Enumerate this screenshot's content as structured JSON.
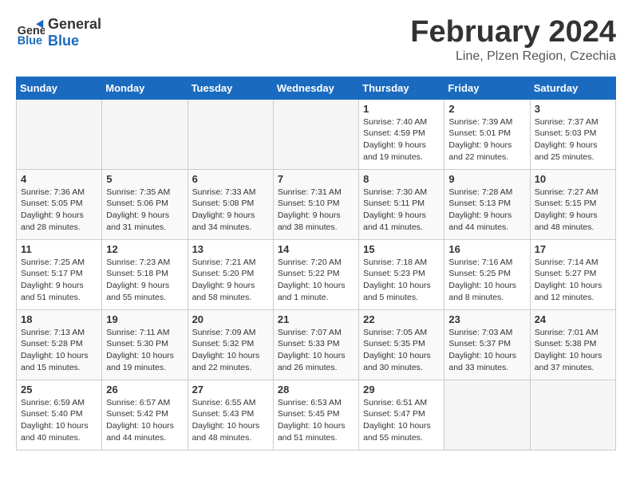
{
  "header": {
    "logo_line1": "General",
    "logo_line2": "Blue",
    "title": "February 2024",
    "subtitle": "Line, Plzen Region, Czechia"
  },
  "weekdays": [
    "Sunday",
    "Monday",
    "Tuesday",
    "Wednesday",
    "Thursday",
    "Friday",
    "Saturday"
  ],
  "weeks": [
    [
      {
        "day": "",
        "info": ""
      },
      {
        "day": "",
        "info": ""
      },
      {
        "day": "",
        "info": ""
      },
      {
        "day": "",
        "info": ""
      },
      {
        "day": "1",
        "info": "Sunrise: 7:40 AM\nSunset: 4:59 PM\nDaylight: 9 hours\nand 19 minutes."
      },
      {
        "day": "2",
        "info": "Sunrise: 7:39 AM\nSunset: 5:01 PM\nDaylight: 9 hours\nand 22 minutes."
      },
      {
        "day": "3",
        "info": "Sunrise: 7:37 AM\nSunset: 5:03 PM\nDaylight: 9 hours\nand 25 minutes."
      }
    ],
    [
      {
        "day": "4",
        "info": "Sunrise: 7:36 AM\nSunset: 5:05 PM\nDaylight: 9 hours\nand 28 minutes."
      },
      {
        "day": "5",
        "info": "Sunrise: 7:35 AM\nSunset: 5:06 PM\nDaylight: 9 hours\nand 31 minutes."
      },
      {
        "day": "6",
        "info": "Sunrise: 7:33 AM\nSunset: 5:08 PM\nDaylight: 9 hours\nand 34 minutes."
      },
      {
        "day": "7",
        "info": "Sunrise: 7:31 AM\nSunset: 5:10 PM\nDaylight: 9 hours\nand 38 minutes."
      },
      {
        "day": "8",
        "info": "Sunrise: 7:30 AM\nSunset: 5:11 PM\nDaylight: 9 hours\nand 41 minutes."
      },
      {
        "day": "9",
        "info": "Sunrise: 7:28 AM\nSunset: 5:13 PM\nDaylight: 9 hours\nand 44 minutes."
      },
      {
        "day": "10",
        "info": "Sunrise: 7:27 AM\nSunset: 5:15 PM\nDaylight: 9 hours\nand 48 minutes."
      }
    ],
    [
      {
        "day": "11",
        "info": "Sunrise: 7:25 AM\nSunset: 5:17 PM\nDaylight: 9 hours\nand 51 minutes."
      },
      {
        "day": "12",
        "info": "Sunrise: 7:23 AM\nSunset: 5:18 PM\nDaylight: 9 hours\nand 55 minutes."
      },
      {
        "day": "13",
        "info": "Sunrise: 7:21 AM\nSunset: 5:20 PM\nDaylight: 9 hours\nand 58 minutes."
      },
      {
        "day": "14",
        "info": "Sunrise: 7:20 AM\nSunset: 5:22 PM\nDaylight: 10 hours\nand 1 minute."
      },
      {
        "day": "15",
        "info": "Sunrise: 7:18 AM\nSunset: 5:23 PM\nDaylight: 10 hours\nand 5 minutes."
      },
      {
        "day": "16",
        "info": "Sunrise: 7:16 AM\nSunset: 5:25 PM\nDaylight: 10 hours\nand 8 minutes."
      },
      {
        "day": "17",
        "info": "Sunrise: 7:14 AM\nSunset: 5:27 PM\nDaylight: 10 hours\nand 12 minutes."
      }
    ],
    [
      {
        "day": "18",
        "info": "Sunrise: 7:13 AM\nSunset: 5:28 PM\nDaylight: 10 hours\nand 15 minutes."
      },
      {
        "day": "19",
        "info": "Sunrise: 7:11 AM\nSunset: 5:30 PM\nDaylight: 10 hours\nand 19 minutes."
      },
      {
        "day": "20",
        "info": "Sunrise: 7:09 AM\nSunset: 5:32 PM\nDaylight: 10 hours\nand 22 minutes."
      },
      {
        "day": "21",
        "info": "Sunrise: 7:07 AM\nSunset: 5:33 PM\nDaylight: 10 hours\nand 26 minutes."
      },
      {
        "day": "22",
        "info": "Sunrise: 7:05 AM\nSunset: 5:35 PM\nDaylight: 10 hours\nand 30 minutes."
      },
      {
        "day": "23",
        "info": "Sunrise: 7:03 AM\nSunset: 5:37 PM\nDaylight: 10 hours\nand 33 minutes."
      },
      {
        "day": "24",
        "info": "Sunrise: 7:01 AM\nSunset: 5:38 PM\nDaylight: 10 hours\nand 37 minutes."
      }
    ],
    [
      {
        "day": "25",
        "info": "Sunrise: 6:59 AM\nSunset: 5:40 PM\nDaylight: 10 hours\nand 40 minutes."
      },
      {
        "day": "26",
        "info": "Sunrise: 6:57 AM\nSunset: 5:42 PM\nDaylight: 10 hours\nand 44 minutes."
      },
      {
        "day": "27",
        "info": "Sunrise: 6:55 AM\nSunset: 5:43 PM\nDaylight: 10 hours\nand 48 minutes."
      },
      {
        "day": "28",
        "info": "Sunrise: 6:53 AM\nSunset: 5:45 PM\nDaylight: 10 hours\nand 51 minutes."
      },
      {
        "day": "29",
        "info": "Sunrise: 6:51 AM\nSunset: 5:47 PM\nDaylight: 10 hours\nand 55 minutes."
      },
      {
        "day": "",
        "info": ""
      },
      {
        "day": "",
        "info": ""
      }
    ]
  ]
}
